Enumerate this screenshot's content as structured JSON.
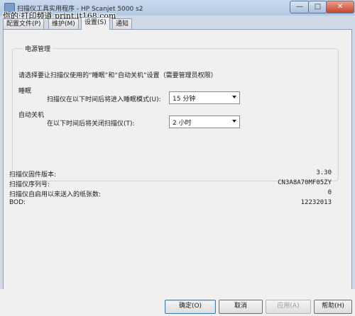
{
  "window": {
    "title": "扫描仪工具实用程序 - HP Scanjet 5000 s2",
    "watermark": "你的·打印频道 print.it168.com",
    "minimize_glyph": "—",
    "maximize_glyph": "□",
    "close_glyph": "✕"
  },
  "tabs": [
    {
      "label": "配置文件(P)"
    },
    {
      "label": "维护(M)"
    },
    {
      "label": "设置(S)",
      "active": true
    },
    {
      "label": "通知"
    }
  ],
  "power": {
    "group_title": "电源管理",
    "description": "请选择要让扫描仪使用的“睡眠”和“自动关机”设置（需要管理员权限）",
    "sleep_heading": "睡眠",
    "sleep_label": "扫描仪在以下时间后将进入睡眠模式(U):",
    "sleep_value": "15 分钟",
    "autooff_heading": "自动关机",
    "autooff_label": "在以下时间后将关闭扫描仪(T):",
    "autooff_value": "2 小时"
  },
  "info": [
    {
      "label": "扫描仪固件版本:",
      "value": "3.30"
    },
    {
      "label": "扫描仪序列号:",
      "value": "CN3A8A70MF05ZY"
    },
    {
      "label": "扫描仪自启用以来送入的纸张数:",
      "value": "0"
    },
    {
      "label": "BOD:",
      "value": "12232013"
    }
  ],
  "buttons": {
    "ok": "确定(O)",
    "cancel": "取消",
    "apply": "应用(A)",
    "help": "帮助(H)"
  }
}
